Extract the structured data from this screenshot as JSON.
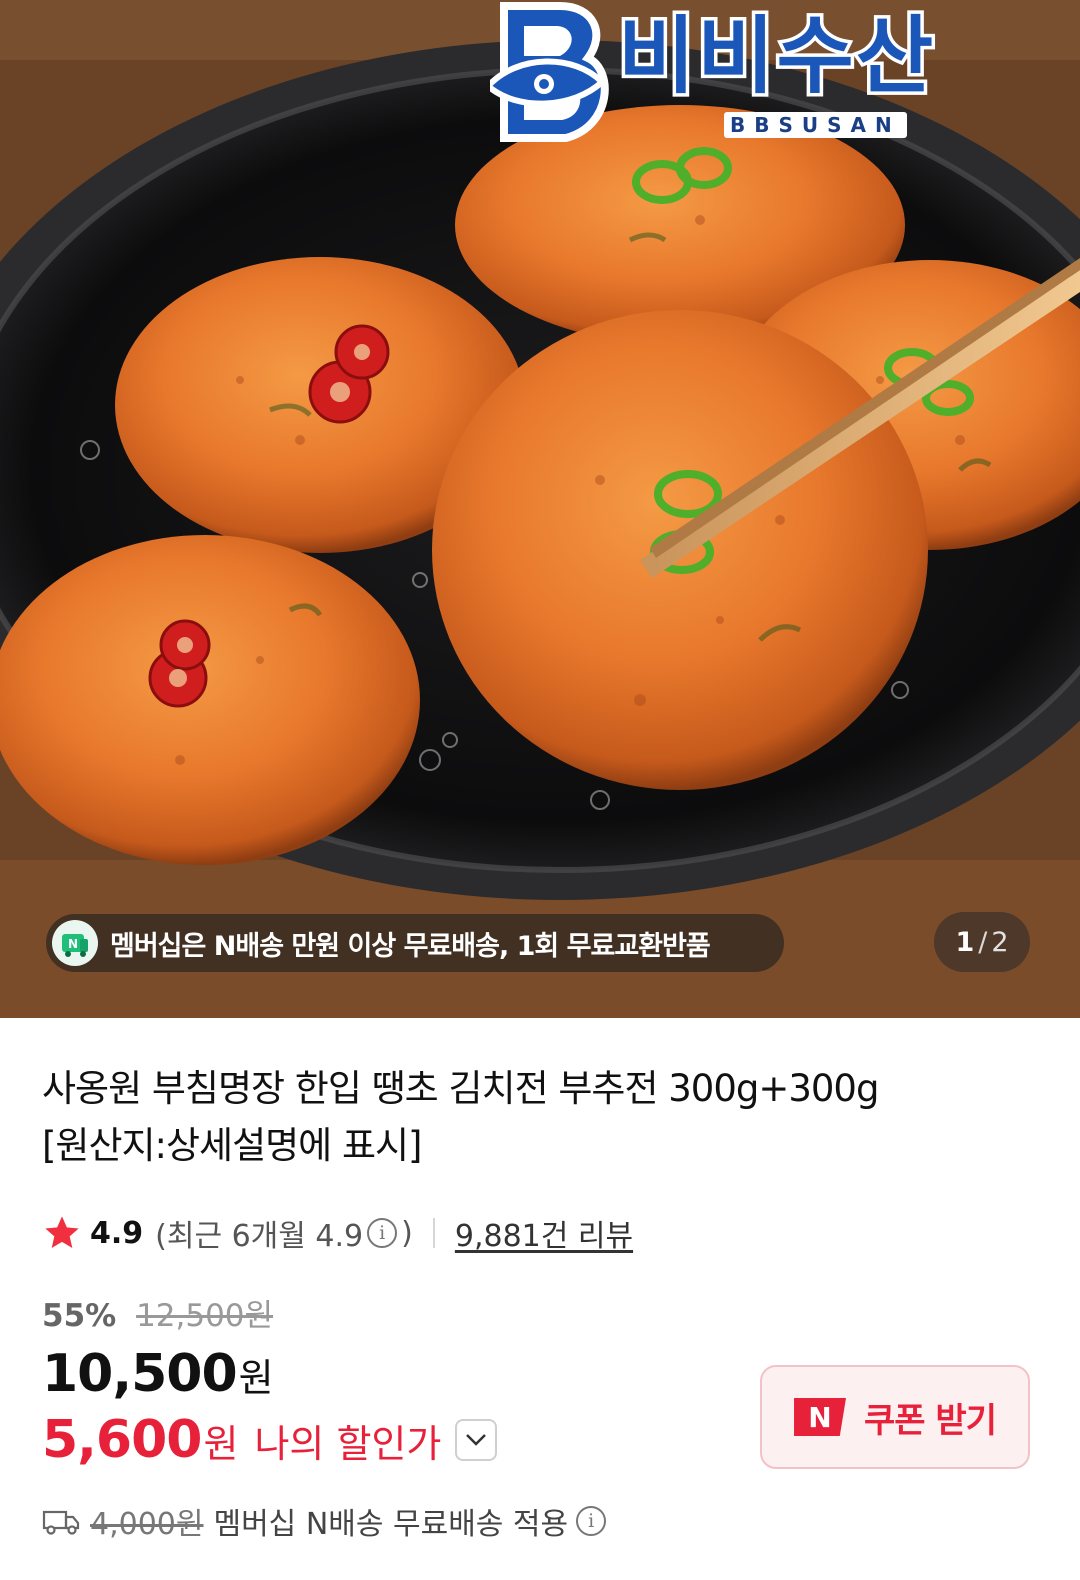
{
  "brand": {
    "name": "비비수산",
    "sub": "BBSUSAN"
  },
  "membership_banner": {
    "text": "멤버십은 N배송 만원 이상 무료배송, 1회 무료교환반품",
    "icon": "naver-membership-icon"
  },
  "image_pager": {
    "current": "1",
    "separator": "/",
    "total": "2"
  },
  "product": {
    "title_line1": "사옹원 부침명장 한입 땡초 김치전 부추전 300g+300g",
    "title_line2": "[원산지:상세설명에 표시]"
  },
  "rating": {
    "icon": "star-icon",
    "score": "4.9",
    "recent_prefix": "(최근 6개월 4.9",
    "recent_suffix": ")",
    "info_icon": "info-icon",
    "review_count": "9,881건 리뷰"
  },
  "pricing": {
    "discount_rate": "55%",
    "original_price": "12,500원",
    "sale_price": "10,500",
    "sale_unit": "원",
    "my_price": "5,600",
    "my_unit": "원",
    "my_label": "나의 할인가",
    "chevron_icon": "chevron-down-icon"
  },
  "coupon": {
    "badge": "N",
    "label": "쿠폰 받기"
  },
  "shipping": {
    "icon": "truck-icon",
    "old_fee": "4,000원",
    "text": "멤버십 N배송 무료배송 적용"
  },
  "colors": {
    "accent_red": "#e8213a",
    "brand_blue": "#1b57b8"
  }
}
